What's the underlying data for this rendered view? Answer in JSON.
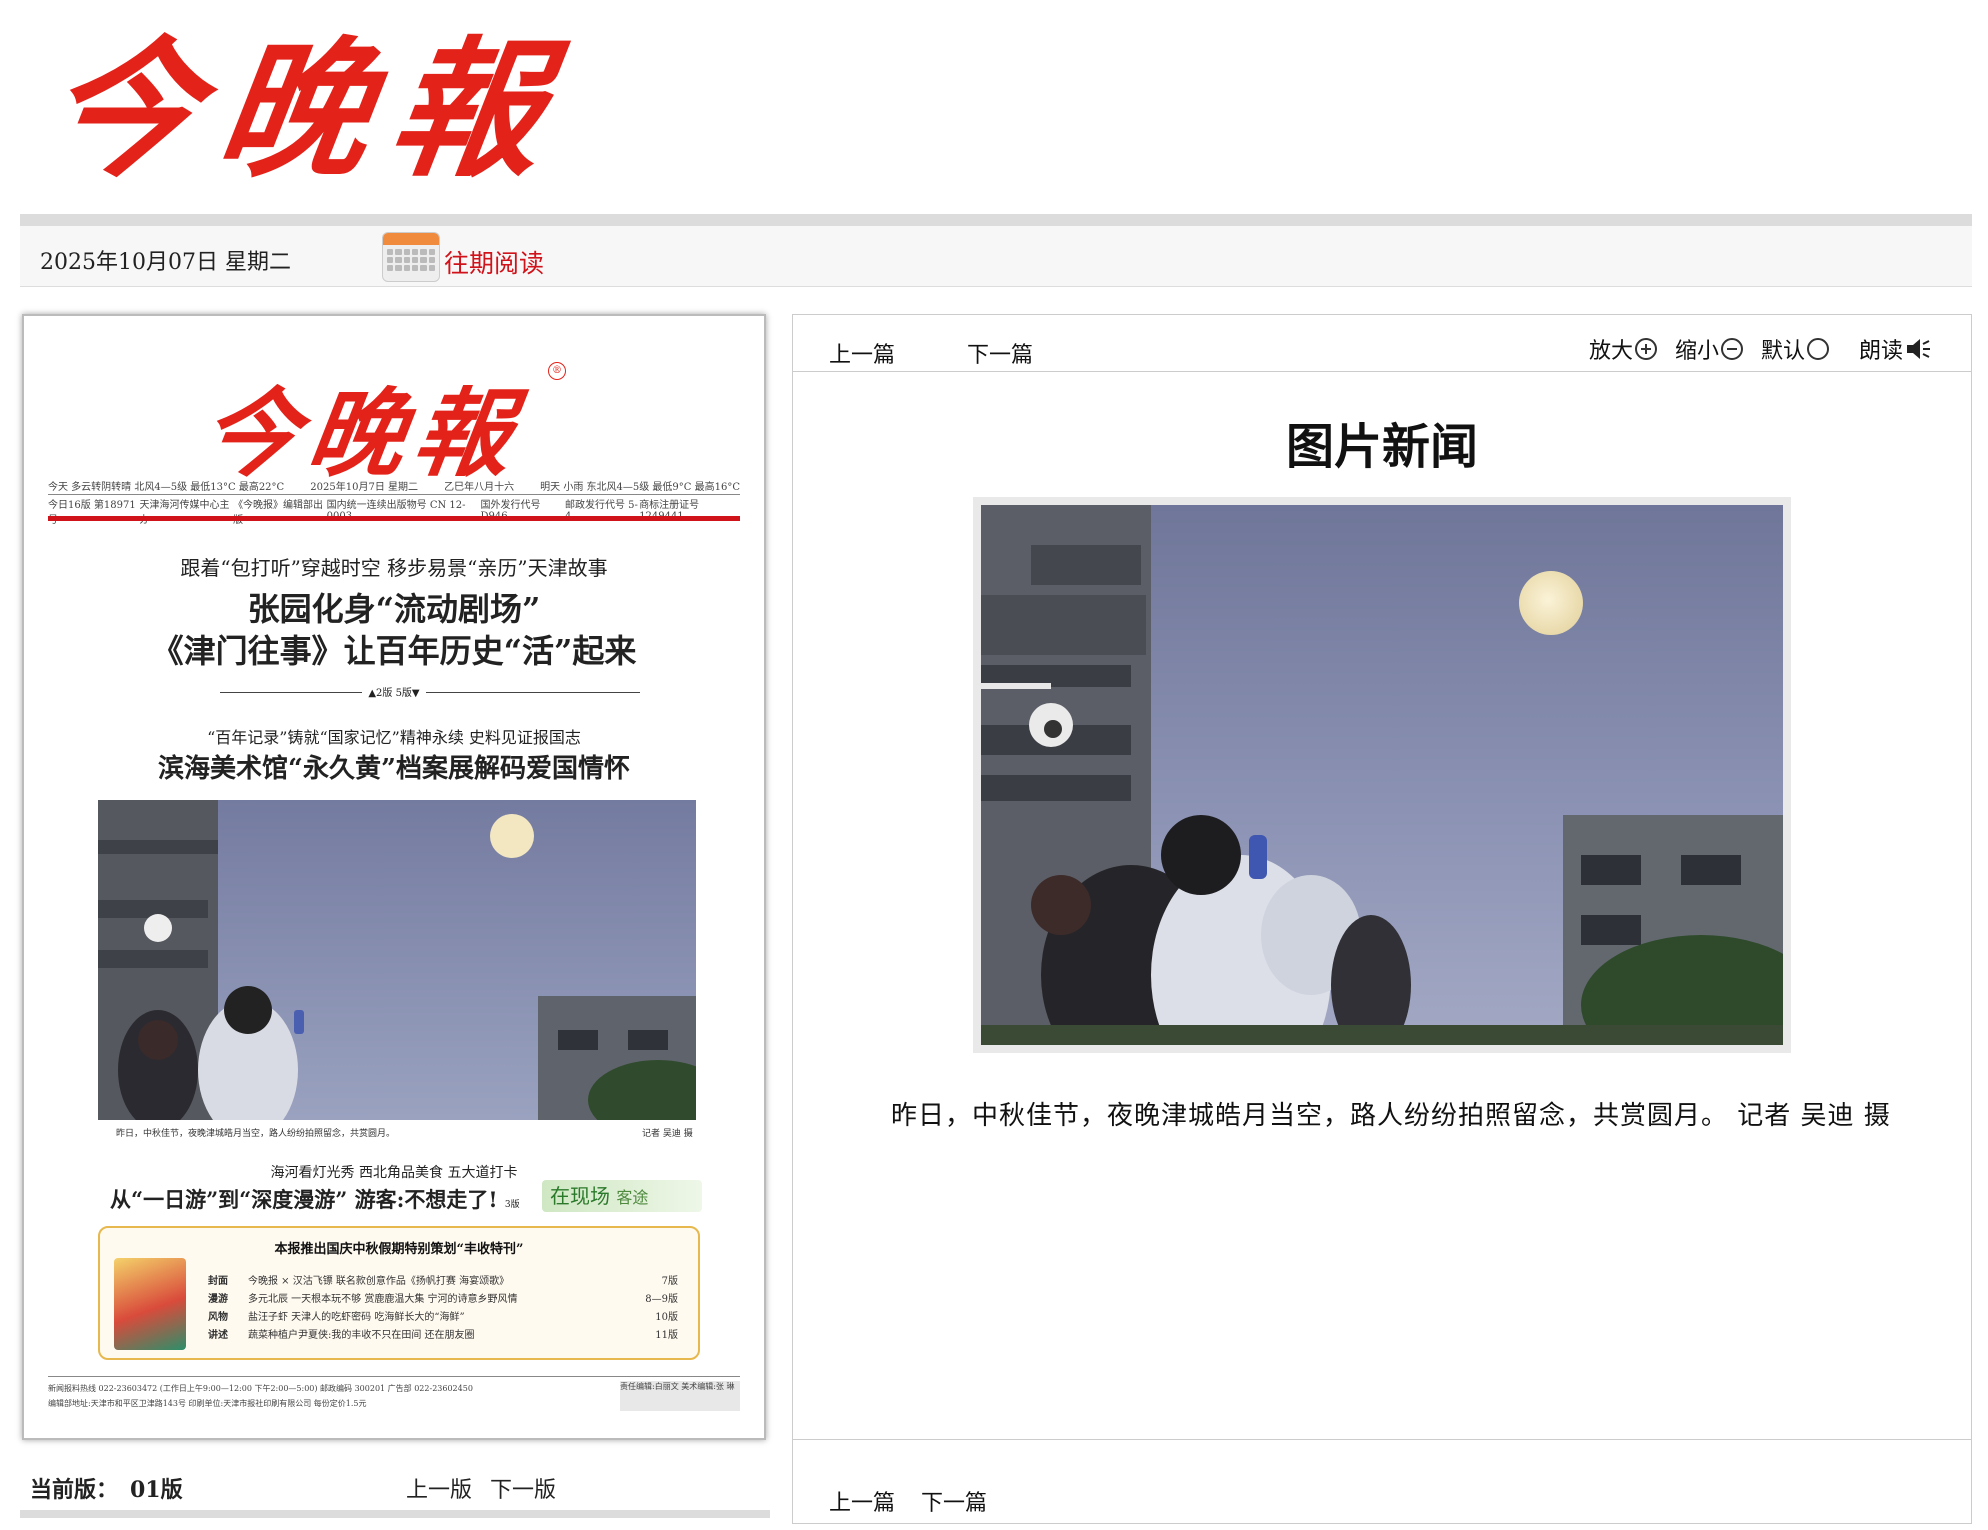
{
  "masthead": {
    "logo_text": "今晚報"
  },
  "datebar": {
    "date": "2025年10月07日 星期二",
    "past_issues_label": "往期阅读",
    "accent_color": "#d0121a"
  },
  "paper": {
    "logo_text": "今晚報",
    "registered_mark": "®",
    "strip_row1": [
      "今天 多云转阴转晴 北风4—5级 最低13°C 最高22°C",
      "2025年10月7日 星期二",
      "乙巳年八月十六",
      "明天 小雨 东北风4—5级 最低9°C 最高16°C"
    ],
    "strip_row2": [
      "今日16版 第18971号",
      "天津海河传媒中心主办",
      "《今晚报》编辑部出版",
      "国内统一连续出版物号 CN 12-0003",
      "国外发行代号 D946",
      "邮政发行代号 5-4",
      "商标注册证号 1249441"
    ],
    "headline1_kicker": "跟着“包打听”穿越时空 移步易景“亲历”天津故事",
    "headline1_line1": "张园化身“流动剧场”",
    "headline1_line2": "《津门往事》让百年历史“活”起来",
    "headline1_pageref": "▲2版 5版▼",
    "headline2_kicker": "“百年记录”铸就“国家记忆”精神永续 史料见证报国志",
    "headline2_main": "滨海美术馆“永久黄”档案展解码爱国情怀",
    "photo_caption": "昨日，中秋佳节，夜晚津城皓月当空，路人纷纷拍照留念，共赏圆月。",
    "photo_credit": "记者 吴迪 摄",
    "headline3_kicker": "海河看灯光秀 西北角品美食 五大道打卡",
    "headline3_main": "从“一日游”到“深度漫游” 游客:不想走了!",
    "headline3_pageref": "3版",
    "badge_label": "在现场",
    "badge_sub": "客途",
    "promo_title": "本报推出国庆中秋假期特别策划“丰收特刊”",
    "promo_rows": [
      {
        "tag": "封面",
        "text": "今晚报 × 汉沽飞镖 联名款创意作品《扬帆打赛 海宴颂歌》",
        "page": "7版"
      },
      {
        "tag": "漫游",
        "text": "多元北辰 一天根本玩不够 赏鹿鹿温大集 宁河的诗意乡野风情",
        "page": "8—9版"
      },
      {
        "tag": "风物",
        "text": "盐汪子虾 天津人的吃虾密码 吃海鲜长大的“海鲜”",
        "page": "10版"
      },
      {
        "tag": "讲述",
        "text": "蔬菜种植户尹夏侠:我的丰收不只在田间 还在朋友圈",
        "page": "11版"
      }
    ],
    "footer_line1": "新闻报料热线 022-23603472 (工作日上午9:00—12:00 下午2:00—5:00) 邮政编码 300201 广告部 022-23602450",
    "footer_line2": "编辑部地址:天津市和平区卫津路143号 印刷单位:天津市报社印刷有限公司 每份定价1.5元",
    "footer_box": "责任编辑:白丽文 美术编辑:张 琳"
  },
  "edition": {
    "current_label": "当前版：",
    "current_value": "01版",
    "prev_label": "上一版",
    "next_label": "下一版"
  },
  "article": {
    "prev_label": "上一篇",
    "next_label": "下一篇",
    "tools": {
      "zoom_in": "放大",
      "zoom_out": "缩小",
      "default": "默认",
      "read_aloud": "朗读"
    },
    "title": "图片新闻",
    "body": "昨日，中秋佳节，夜晚津城皓月当空，路人纷纷拍照留念，共赏圆月。        记者 吴迪 摄",
    "bottom_prev_label": "上一篇",
    "bottom_next_label": "下一篇"
  }
}
